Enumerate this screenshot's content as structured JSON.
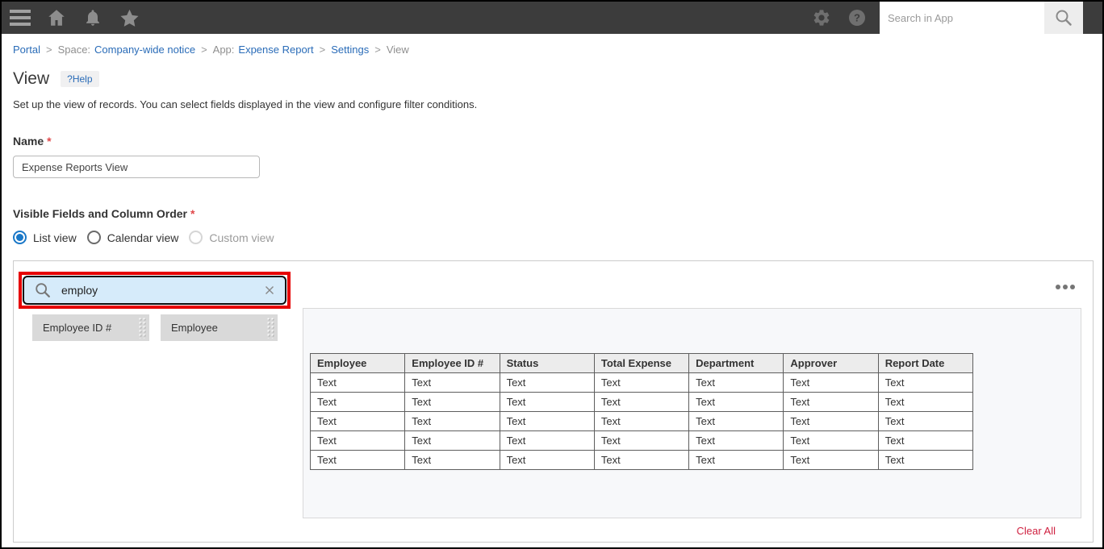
{
  "topbar": {
    "search": {
      "placeholder": "Search in App"
    }
  },
  "breadcrumb": {
    "portal": "Portal",
    "separator": ">",
    "space_prefix": "Space:",
    "space_link": "Company-wide notice",
    "app_prefix": "App:",
    "app_link": "Expense Report",
    "settings_link": "Settings",
    "current": "View"
  },
  "page": {
    "title": "View",
    "help_label": "?Help",
    "description": "Set up the view of records. You can select fields displayed in the view and configure filter conditions."
  },
  "name_field": {
    "label": "Name",
    "required_mark": "*",
    "value": "Expense Reports View"
  },
  "visible_fields": {
    "label": "Visible Fields and Column Order",
    "required_mark": "*",
    "view_options": [
      {
        "label": "List view",
        "state": "selected"
      },
      {
        "label": "Calendar view",
        "state": "unselected"
      },
      {
        "label": "Custom view",
        "state": "disabled"
      }
    ]
  },
  "field_picker": {
    "search_value": "employ",
    "fields": [
      {
        "label": "Employee ID #"
      },
      {
        "label": "Employee"
      }
    ]
  },
  "preview_table": {
    "columns": [
      "Employee",
      "Employee ID #",
      "Status",
      "Total Expense",
      "Department",
      "Approver",
      "Report Date"
    ],
    "rows": [
      [
        "Text",
        "Text",
        "Text",
        "Text",
        "Text",
        "Text",
        "Text"
      ],
      [
        "Text",
        "Text",
        "Text",
        "Text",
        "Text",
        "Text",
        "Text"
      ],
      [
        "Text",
        "Text",
        "Text",
        "Text",
        "Text",
        "Text",
        "Text"
      ],
      [
        "Text",
        "Text",
        "Text",
        "Text",
        "Text",
        "Text",
        "Text"
      ],
      [
        "Text",
        "Text",
        "Text",
        "Text",
        "Text",
        "Text",
        "Text"
      ]
    ]
  },
  "footer": {
    "clear_all_label": "Clear All"
  },
  "icons": {
    "menu": "☰",
    "home": "⌂",
    "notifications": "🔔",
    "favorites": "★",
    "settings_gear": "⚙",
    "help": "?",
    "search": "🔍",
    "clear_search": "✕",
    "options_menu": "•••",
    "drag_handle": "⠿"
  },
  "colors": {
    "topbar_bg": "#3c3c3c",
    "accent_blue": "#1a78c8",
    "link_blue": "#2a6cb8",
    "annotation_red": "#e60000",
    "clear_all_red": "#cf2140",
    "search_pill_bg": "#d6ebfa",
    "chip_bg": "#d9d9d9",
    "table_header_bg": "#ececec"
  }
}
